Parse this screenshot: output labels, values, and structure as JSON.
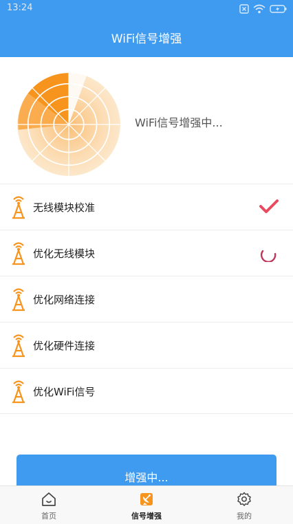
{
  "status_bar": {
    "time": "13:24",
    "icons": [
      "notification-icon",
      "wifi-icon",
      "battery-charging-icon"
    ]
  },
  "header": {
    "title": "WiFi信号增强"
  },
  "radar": {
    "status_text": "WiFi信号增强中...",
    "accent_color": "#f7941d"
  },
  "tasks": [
    {
      "label": "无线模块校准",
      "status": "done",
      "icon": "signal-tower-icon"
    },
    {
      "label": "优化无线模块",
      "status": "in-progress",
      "icon": "signal-tower-icon"
    },
    {
      "label": "优化网络连接",
      "status": "pending",
      "icon": "signal-tower-icon"
    },
    {
      "label": "优化硬件连接",
      "status": "pending",
      "icon": "signal-tower-icon"
    },
    {
      "label": "优化WiFi信号",
      "status": "pending",
      "icon": "signal-tower-icon"
    }
  ],
  "action_button": {
    "label": "增强中..."
  },
  "bottom_nav": {
    "items": [
      {
        "label": "首页",
        "icon": "home-icon",
        "active": false
      },
      {
        "label": "信号增强",
        "icon": "satellite-dish-icon",
        "active": true
      },
      {
        "label": "我的",
        "icon": "settings-gear-icon",
        "active": false
      }
    ]
  },
  "colors": {
    "primary": "#3f9bf0",
    "accent": "#f7941d",
    "done_check": "#e84a5f",
    "spinner": "#c0365a"
  }
}
